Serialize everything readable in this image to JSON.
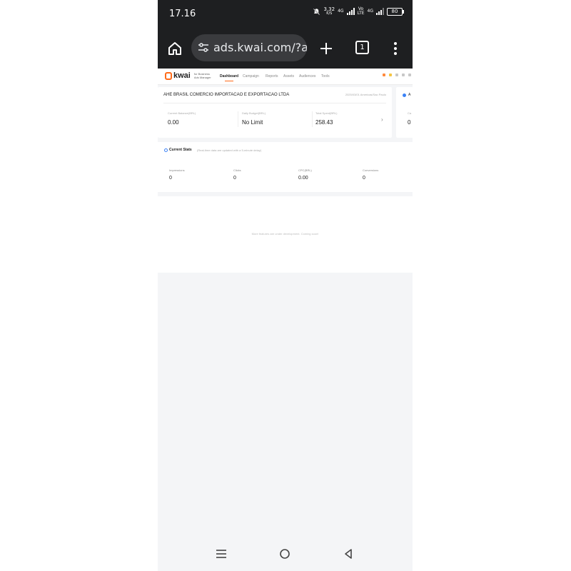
{
  "status_bar": {
    "time": "17.16",
    "speed_value": "3,32",
    "speed_unit": "K/S",
    "network_1": "4G",
    "network_2_top": "Vo",
    "network_2_bottom": "LTE",
    "network_3": "4G",
    "battery": "80",
    "icons": [
      "bell-muted-icon",
      "signal-icon",
      "battery-icon"
    ]
  },
  "browser": {
    "url": "ads.kwai.com/?ac",
    "tab_count": "1",
    "icons": [
      "home-icon",
      "site-settings-icon",
      "new-tab-icon",
      "tabs-icon",
      "more-vert-icon"
    ]
  },
  "ads_nav": {
    "logo_text": "kwai",
    "logo_sub_1": "for Business",
    "logo_sub_2": "Ads Manager",
    "tabs": [
      "Dashboard",
      "Campaign",
      "Reports",
      "Assets",
      "Audiences",
      "Tools"
    ]
  },
  "account_card": {
    "name": "AHE BRASIL COMERCIO IMPORTACAO E EXPORTACAO LTDA",
    "meta": "2025/03/01 Americas/Sao Paulo",
    "metrics": [
      {
        "label": "Current Balance(BRL)",
        "value": "0.00"
      },
      {
        "label": "Daily Budget(BRL)",
        "value": "No Limit"
      },
      {
        "label": "Total Spent(BRL)",
        "value": "258.43"
      }
    ],
    "partial_card": {
      "label": "A",
      "metric_label": "Ca",
      "value": "0"
    }
  },
  "current_stats": {
    "title": "Current Stats",
    "subtitle": "(Real-time data are updated with a 5-minute delay)",
    "metrics": [
      {
        "label": "Impressions",
        "value": "0"
      },
      {
        "label": "Clicks",
        "value": "0"
      },
      {
        "label": "CPC(BRL)",
        "value": "0.00"
      },
      {
        "label": "Conversions",
        "value": "0"
      }
    ]
  },
  "footer_card": {
    "text": "More features are under development. Coming soon!"
  },
  "system_nav": {
    "icons": [
      "recents-icon",
      "home-circle-icon",
      "back-icon"
    ]
  },
  "colors": {
    "bar_dark": "#1e1f21",
    "kwai_orange": "#ff6b1a",
    "accent_blue": "#3b82f6",
    "page_bg": "#f4f5f7"
  }
}
